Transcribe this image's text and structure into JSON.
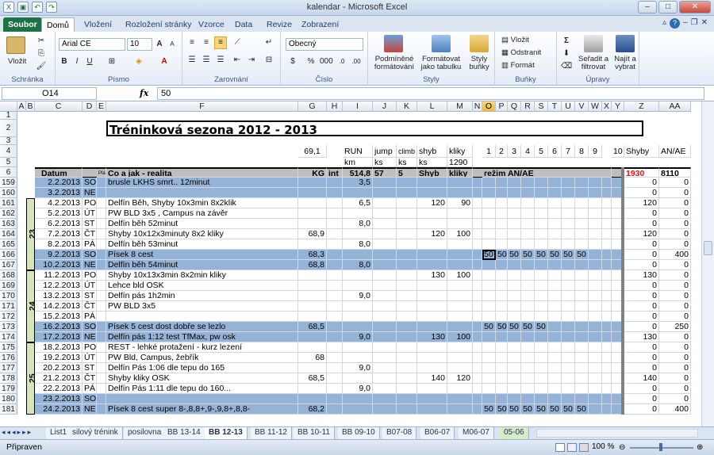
{
  "window": {
    "title": "kalendar - Microsoft Excel"
  },
  "tabs": [
    "Soubor",
    "Domů",
    "Vložení",
    "Rozložení stránky",
    "Vzorce",
    "Data",
    "Revize",
    "Zobrazení"
  ],
  "ribbon": {
    "groups": [
      "Schránka",
      "Písmo",
      "Zarovnání",
      "Číslo",
      "Styly",
      "Buňky",
      "Úpravy"
    ],
    "paste": "Vložit",
    "font_name": "Arial CE",
    "font_size": "10",
    "number_format": "Obecný",
    "cond_format": "Podmíněné formátování",
    "table_format": "Formátovat jako tabulku",
    "cell_styles": "Styly buňky",
    "insert": "Vložit",
    "delete": "Odstranit",
    "format": "Formát",
    "sort": "Seřadit a filtrovat",
    "find": "Najít a vybrat",
    "sum": "Σ"
  },
  "formula_bar": {
    "cell": "O14",
    "value": "50"
  },
  "columns": [
    "A",
    "B",
    "C",
    "D",
    "E",
    "F",
    "G",
    "H",
    "I",
    "J",
    "K",
    "L",
    "M",
    "N",
    "O",
    "P",
    "Q",
    "R",
    "S",
    "T",
    "U",
    "V",
    "W",
    "X",
    "Y",
    "Z",
    "AA"
  ],
  "sheet": {
    "title": "Tréninková sezona 2012 - 2013",
    "row4": {
      "G": "69,1",
      "I": "RUN",
      "J": "jump",
      "K": "climb",
      "L": "shyb",
      "M": "kliky",
      "nums": [
        "1",
        "2",
        "3",
        "4",
        "5",
        "6",
        "7",
        "8",
        "9",
        "10"
      ],
      "Z": "Shyby",
      "AA": "AN/AE"
    },
    "row5": {
      "I": "km",
      "J": "ks",
      "K": "ks",
      "L": "ks",
      "M": "1290"
    },
    "row6": {
      "C": "Datum",
      "E": "Plán",
      "F": "Co  a jak - realita",
      "G": "KG",
      "H": "int",
      "I": "514,8",
      "J": "57",
      "K": "5",
      "L": "Shyb",
      "M": "kliky",
      "O": "režim AN/AE",
      "Z": "1930",
      "AA": "8110"
    },
    "week_labels": [
      "23",
      "24",
      "25"
    ],
    "rows": [
      {
        "n": "159",
        "date": "2.2.2013",
        "day": "SO",
        "text": "brusle LKHS smrt.. 12minut",
        "kg": "",
        "run": "3,5",
        "shyb": "",
        "kliky": "",
        "anae": [],
        "z": "0",
        "aa": "0",
        "blue": true
      },
      {
        "n": "160",
        "date": "3.2.2013",
        "day": "NE",
        "text": "",
        "kg": "",
        "run": "",
        "shyb": "",
        "kliky": "",
        "anae": [],
        "z": "0",
        "aa": "0",
        "blue": true
      },
      {
        "n": "161",
        "date": "4.2.2013",
        "day": "PO",
        "text": "Delfín Běh, Shyby 10x3min 8x2klik",
        "kg": "",
        "run": "6,5",
        "shyb": "120",
        "kliky": "90",
        "anae": [],
        "z": "120",
        "aa": "0",
        "blue": false
      },
      {
        "n": "162",
        "date": "5.2.2013",
        "day": "ÚT",
        "text": "PW BLD 3x5 , Campus na závěr",
        "kg": "",
        "run": "",
        "shyb": "",
        "kliky": "",
        "anae": [],
        "z": "0",
        "aa": "0",
        "blue": false
      },
      {
        "n": "163",
        "date": "6.2.2013",
        "day": "ST",
        "text": "Delfín běh 52minut",
        "kg": "",
        "run": "8,0",
        "shyb": "",
        "kliky": "",
        "anae": [],
        "z": "0",
        "aa": "0",
        "blue": false
      },
      {
        "n": "164",
        "date": "7.2.2013",
        "day": "ČT",
        "text": "Shyby 10x12x3minuty 8x2 kliky",
        "kg": "68,9",
        "run": "",
        "shyb": "120",
        "kliky": "100",
        "anae": [],
        "z": "120",
        "aa": "0",
        "blue": false
      },
      {
        "n": "165",
        "date": "8.2.2013",
        "day": "PÁ",
        "text": "Delfín běh 53minut",
        "kg": "",
        "run": "8,0",
        "shyb": "",
        "kliky": "",
        "anae": [],
        "z": "0",
        "aa": "0",
        "blue": false
      },
      {
        "n": "166",
        "date": "9.2.2013",
        "day": "SO",
        "text": "Písek 8 cest",
        "kg": "68,3",
        "run": "",
        "shyb": "",
        "kliky": "",
        "anae": [
          "50",
          "50",
          "50",
          "50",
          "50",
          "50",
          "50",
          "50"
        ],
        "z": "0",
        "aa": "400",
        "blue": true
      },
      {
        "n": "167",
        "date": "10.2.2013",
        "day": "NE",
        "text": "Delfín běh 54minut",
        "kg": "68,8",
        "run": "8,0",
        "shyb": "",
        "kliky": "",
        "anae": [],
        "z": "0",
        "aa": "0",
        "blue": true
      },
      {
        "n": "168",
        "date": "11.2.2013",
        "day": "PO",
        "text": "Shyby 10x13x3min 8x2min kliky",
        "kg": "",
        "run": "",
        "shyb": "130",
        "kliky": "100",
        "anae": [],
        "z": "130",
        "aa": "0",
        "blue": false
      },
      {
        "n": "169",
        "date": "12.2.2013",
        "day": "ÚT",
        "text": "Lehce bld OSK",
        "kg": "",
        "run": "",
        "shyb": "",
        "kliky": "",
        "anae": [],
        "z": "0",
        "aa": "0",
        "blue": false
      },
      {
        "n": "170",
        "date": "13.2.2013",
        "day": "ST",
        "text": "Delfín pás 1h2min",
        "kg": "",
        "run": "9,0",
        "shyb": "",
        "kliky": "",
        "anae": [],
        "z": "0",
        "aa": "0",
        "blue": false
      },
      {
        "n": "171",
        "date": "14.2.2013",
        "day": "ČT",
        "text": "PW BLD 3x5",
        "kg": "",
        "run": "",
        "shyb": "",
        "kliky": "",
        "anae": [],
        "z": "0",
        "aa": "0",
        "blue": false
      },
      {
        "n": "172",
        "date": "15.2.2013",
        "day": "PÁ",
        "text": "",
        "kg": "",
        "run": "",
        "shyb": "",
        "kliky": "",
        "anae": [],
        "z": "0",
        "aa": "0",
        "blue": false
      },
      {
        "n": "173",
        "date": "16.2.2013",
        "day": "SO",
        "text": "Písek 5 cest dost dobře se lezlo",
        "kg": "68,5",
        "run": "",
        "shyb": "",
        "kliky": "",
        "anae": [
          "50",
          "50",
          "50",
          "50",
          "50"
        ],
        "z": "0",
        "aa": "250",
        "blue": true
      },
      {
        "n": "174",
        "date": "17.2.2013",
        "day": "NE",
        "text": "Delfín pás 1:12 test TfMax, pw osk",
        "kg": "",
        "run": "9,0",
        "shyb": "130",
        "kliky": "100",
        "anae": [],
        "z": "130",
        "aa": "0",
        "blue": true
      },
      {
        "n": "175",
        "date": "18.2.2013",
        "day": "PO",
        "text": "REST - lehké protažení - kurz lezení",
        "kg": "",
        "run": "",
        "shyb": "",
        "kliky": "",
        "anae": [],
        "z": "0",
        "aa": "0",
        "blue": false
      },
      {
        "n": "176",
        "date": "19.2.2013",
        "day": "ÚT",
        "text": "PW Bld, Campus, žebřík",
        "kg": "68",
        "run": "",
        "shyb": "",
        "kliky": "",
        "anae": [],
        "z": "0",
        "aa": "0",
        "blue": false
      },
      {
        "n": "177",
        "date": "20.2.2013",
        "day": "ST",
        "text": "Delfín Pás 1:06 dle tepu do 165",
        "kg": "",
        "run": "9,0",
        "shyb": "",
        "kliky": "",
        "anae": [],
        "z": "0",
        "aa": "0",
        "blue": false
      },
      {
        "n": "178",
        "date": "21.2.2013",
        "day": "ČT",
        "text": "Shyby kliky OSK",
        "kg": "68,5",
        "run": "",
        "shyb": "140",
        "kliky": "120",
        "anae": [],
        "z": "140",
        "aa": "0",
        "blue": false
      },
      {
        "n": "179",
        "date": "22.2.2013",
        "day": "PÁ",
        "text": "Delfín Pás 1:11 dle tepu do 160...",
        "kg": "",
        "run": "9,0",
        "shyb": "",
        "kliky": "",
        "anae": [],
        "z": "0",
        "aa": "0",
        "blue": false
      },
      {
        "n": "180",
        "date": "23.2.2013",
        "day": "SO",
        "text": "",
        "kg": "",
        "run": "",
        "shyb": "",
        "kliky": "",
        "anae": [],
        "z": "0",
        "aa": "0",
        "blue": true
      },
      {
        "n": "181",
        "date": "24.2.2013",
        "day": "NE",
        "text": "Písek 8 cest super 8-,8,8+,9-,9,8+,8,8-",
        "kg": "68,2",
        "run": "",
        "shyb": "",
        "kliky": "",
        "anae": [
          "50",
          "50",
          "50",
          "50",
          "50",
          "50",
          "50",
          "50"
        ],
        "z": "0",
        "aa": "400",
        "blue": true
      }
    ]
  },
  "sheet_tabs": [
    "List1",
    "silový trénink",
    "posilovna",
    "BB 13-14",
    "BB 12-13",
    "BB 11-12",
    "BB 10-11",
    "BB 09-10",
    "B07-08",
    "B06-07",
    "M06-07",
    "05-06"
  ],
  "status": {
    "ready": "Připraven",
    "zoom": "100 %"
  },
  "colors": {
    "blue_row": "#95b3d7",
    "green_week": "#d8e4bc",
    "header_gray": "#bfbfbf",
    "excel_green": "#1e7145"
  }
}
